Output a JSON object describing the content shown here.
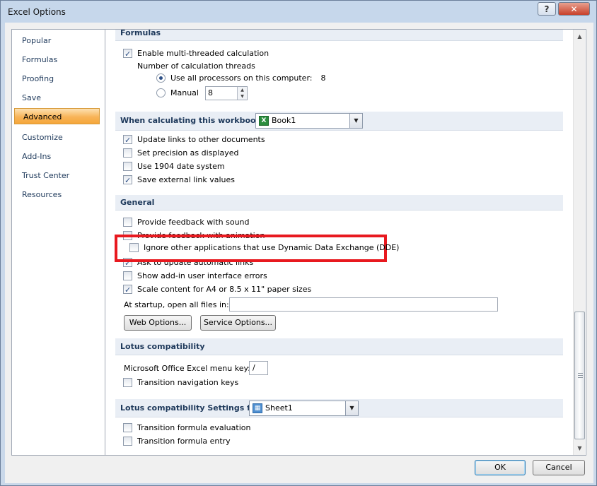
{
  "window": {
    "title": "Excel Options",
    "help": "?",
    "close": "✕"
  },
  "sidebar": {
    "items": [
      {
        "label": "Popular"
      },
      {
        "label": "Formulas"
      },
      {
        "label": "Proofing"
      },
      {
        "label": "Save"
      },
      {
        "label": "Advanced",
        "active": true
      },
      {
        "label": "Customize"
      },
      {
        "label": "Add-Ins"
      },
      {
        "label": "Trust Center"
      },
      {
        "label": "Resources"
      }
    ]
  },
  "formulas": {
    "header": "Formulas",
    "multithread": {
      "label": "Enable multi-threaded calculation",
      "checked": true
    },
    "threads_label": "Number of calculation threads",
    "all_processors": {
      "label": "Use all processors on this computer:",
      "value": "8",
      "selected": true
    },
    "manual": {
      "label": "Manual",
      "value": "8",
      "selected": false
    }
  },
  "workbook": {
    "header": "When calculating this workbook:",
    "combo_value": "Book1",
    "options": [
      {
        "label": "Update links to other documents",
        "checked": true
      },
      {
        "label": "Set precision as displayed",
        "checked": false
      },
      {
        "label": "Use 1904 date system",
        "checked": false
      },
      {
        "label": "Save external link values",
        "checked": true
      }
    ]
  },
  "general": {
    "header": "General",
    "options": [
      {
        "label": "Provide feedback with sound",
        "checked": false
      },
      {
        "label": "Provide feedback with animation",
        "checked": false
      },
      {
        "label": "Ignore other applications that use Dynamic Data Exchange (DDE)",
        "checked": false
      },
      {
        "label": "Ask to update automatic links",
        "checked": true
      },
      {
        "label": "Show add-in user interface errors",
        "checked": false
      },
      {
        "label": "Scale content for A4 or 8.5 x 11\" paper sizes",
        "checked": true
      }
    ],
    "startup_label": "At startup, open all files in:",
    "startup_value": "",
    "web_options": "Web Options...",
    "service_options": "Service Options..."
  },
  "lotus": {
    "header": "Lotus compatibility",
    "menu_key_label": "Microsoft Office Excel menu key:",
    "menu_key_value": "/",
    "nav_keys": {
      "label": "Transition navigation keys",
      "checked": false
    }
  },
  "lotus_settings": {
    "header": "Lotus compatibility Settings for:",
    "combo_value": "Sheet1",
    "options": [
      {
        "label": "Transition formula evaluation",
        "checked": false
      },
      {
        "label": "Transition formula entry",
        "checked": false
      }
    ]
  },
  "footer": {
    "ok": "OK",
    "cancel": "Cancel"
  },
  "colors": {
    "highlight": "#e8191f",
    "active_nav": "#f8b458",
    "section_text": "#1e395b"
  }
}
